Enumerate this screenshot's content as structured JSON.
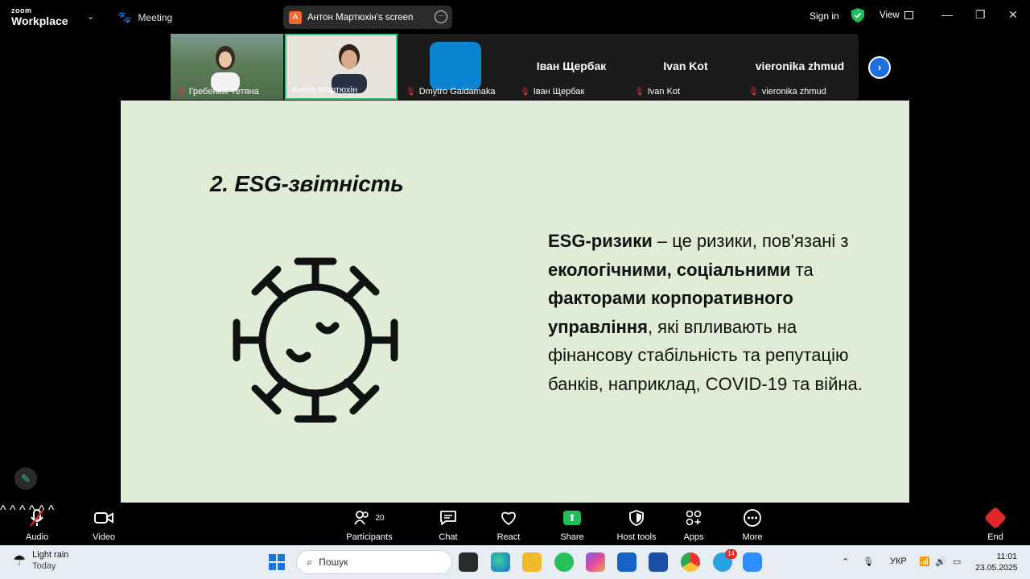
{
  "app": {
    "brand_top": "zoom",
    "brand_bottom": "Workplace",
    "meeting_label": "Meeting"
  },
  "screen_share": {
    "avatar_letter": "A",
    "label": "Антон Мартюхін's screen"
  },
  "header": {
    "signin": "Sign in",
    "view": "View"
  },
  "participants_strip": [
    {
      "name": "Гребенюк Тетяна",
      "muted": true
    },
    {
      "name": "Антон Мартюхін",
      "muted": false
    },
    {
      "name": "Dmytro Gaidamaka",
      "muted": true
    },
    {
      "name": "Іван Щербак",
      "big_name": "Іван Щербак",
      "muted": true
    },
    {
      "name": "Ivan Kot",
      "big_name": "Ivan Kot",
      "muted": true
    },
    {
      "name": "vieronika zhmud",
      "big_name": "vieronika zhmud",
      "muted": true
    }
  ],
  "slide": {
    "title": "2. ESG-звітність",
    "t1": "ESG-ризики",
    "t2": " – це ризики, пов'язані з ",
    "t3": "екологічними, соціальними",
    "t4": " та ",
    "t5": "факторами корпоративного управління",
    "t6": ", які впливають на фінансову стабільність та репутацію банків, наприклад, COVID-19 та війна."
  },
  "toolbar": {
    "audio": "Audio",
    "video": "Video",
    "participants": "Participants",
    "participants_count": "20",
    "chat": "Chat",
    "react": "React",
    "share": "Share",
    "host_tools": "Host tools",
    "apps": "Apps",
    "more": "More",
    "end": "End"
  },
  "taskbar": {
    "weather_title": "Light rain",
    "weather_sub": "Today",
    "search_placeholder": "Пошук",
    "telegram_badge": "14",
    "lang": "УКР",
    "time": "11:01",
    "date": "23.05.2025"
  },
  "colors": {
    "slide_bg": "#e1ecd6",
    "share_green": "#1fbf5b",
    "end_red": "#e02828",
    "active_border": "#2ad17a"
  }
}
